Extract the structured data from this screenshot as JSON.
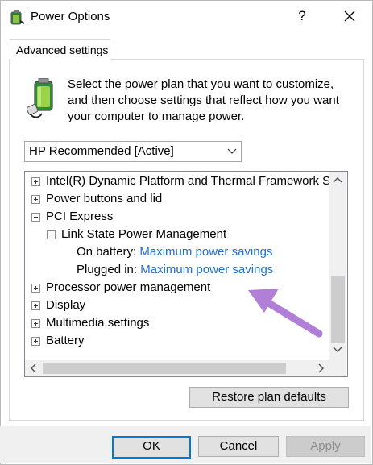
{
  "window": {
    "title": "Power Options",
    "help_label": "?",
    "close_icon": "close-icon"
  },
  "tab": {
    "label": "Advanced settings"
  },
  "intro": {
    "lines": [
      "Select the power plan that you want to customize,",
      "and then choose settings that reflect how you want",
      "your computer to manage power."
    ]
  },
  "plan_select": {
    "value": "HP Recommended [Active]"
  },
  "tree": {
    "items": [
      {
        "label": "Intel(R) Dynamic Platform and Thermal Framework Se"
      },
      {
        "label": "Power buttons and lid"
      },
      {
        "label": "PCI Express"
      },
      {
        "label": "Link State Power Management"
      },
      {
        "label": "On battery:",
        "value": "Maximum power savings"
      },
      {
        "label": "Plugged in:",
        "value": "Maximum power savings"
      },
      {
        "label": "Processor power management"
      },
      {
        "label": "Display"
      },
      {
        "label": "Multimedia settings"
      },
      {
        "label": "Battery"
      }
    ]
  },
  "buttons": {
    "restore": "Restore plan defaults",
    "ok": "OK",
    "cancel": "Cancel",
    "apply": "Apply"
  },
  "colors": {
    "link": "#1e6fd1",
    "focus_border": "#0078d7",
    "annotation_arrow": "#b17ed8"
  }
}
